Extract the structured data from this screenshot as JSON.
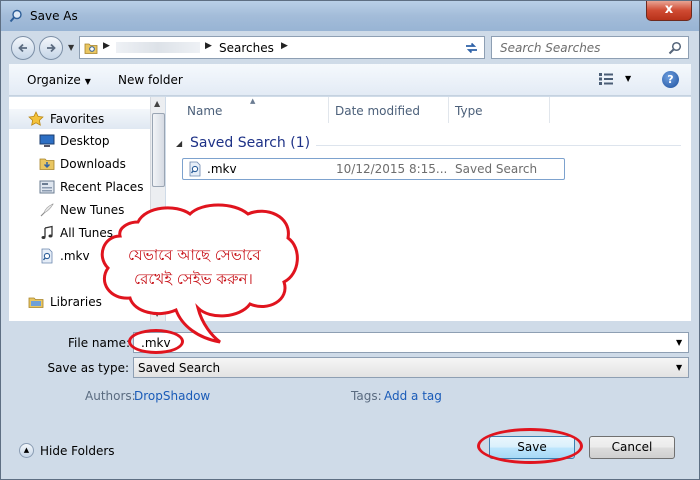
{
  "window": {
    "title": "Save As",
    "close_label": "x"
  },
  "address_bar": {
    "current": "Searches"
  },
  "search": {
    "placeholder": "Search Searches"
  },
  "toolbar": {
    "organize_label": "Organize",
    "new_folder_label": "New folder"
  },
  "nav_pane": {
    "favorites_label": "Favorites",
    "items": [
      {
        "label": "Desktop",
        "icon": "desktop-icon"
      },
      {
        "label": "Downloads",
        "icon": "downloads-folder-icon"
      },
      {
        "label": "Recent Places",
        "icon": "recent-places-icon"
      },
      {
        "label": "New Tunes",
        "icon": "feather-icon"
      },
      {
        "label": "All Tunes",
        "icon": "music-note-icon"
      },
      {
        "label": ".mkv",
        "icon": "saved-search-icon"
      }
    ],
    "libraries_label": "Libraries"
  },
  "file_list": {
    "columns": [
      "Name",
      "Date modified",
      "Type"
    ],
    "group": "Saved Search (1)",
    "rows": [
      {
        "name": ".mkv",
        "date": "10/12/2015 8:15...",
        "type": "Saved Search"
      }
    ]
  },
  "form": {
    "file_name_label": "File name:",
    "file_name_value": ".mkv",
    "save_as_type_label": "Save as type:",
    "save_as_type_value": "Saved Search",
    "authors_label": "Authors:",
    "authors_value": "DropShadow",
    "tags_label": "Tags:",
    "tags_value": "Add a tag"
  },
  "footer": {
    "hide_folders_label": "Hide Folders",
    "save_label": "Save",
    "cancel_label": "Cancel"
  },
  "annotation": {
    "line1": "যেভাবে আছে সেভাবে",
    "line2": "রেখেই সেইভ করুন।",
    "color": "#e0141e"
  }
}
